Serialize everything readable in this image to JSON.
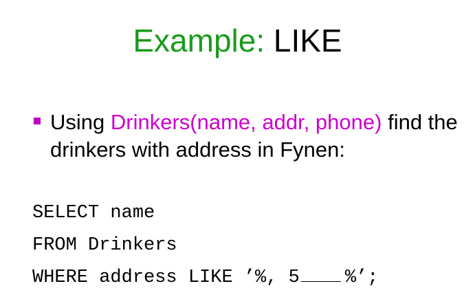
{
  "title": {
    "prefix": "Example:",
    "keyword": "LIKE"
  },
  "bullet": {
    "lead": "Using ",
    "relation": "Drinkers(name, addr, phone)",
    "rest": " find the drinkers with address in Fynen:"
  },
  "query": {
    "line1": "SELECT name",
    "line2": "FROM Drinkers",
    "line3_start": "WHERE address LIKE ’%, 5",
    "line3_end": "%’;"
  },
  "colors": {
    "title_accent": "#1a9a1a",
    "highlight": "#cc00cc",
    "bullet_marker": "#c000c0"
  }
}
